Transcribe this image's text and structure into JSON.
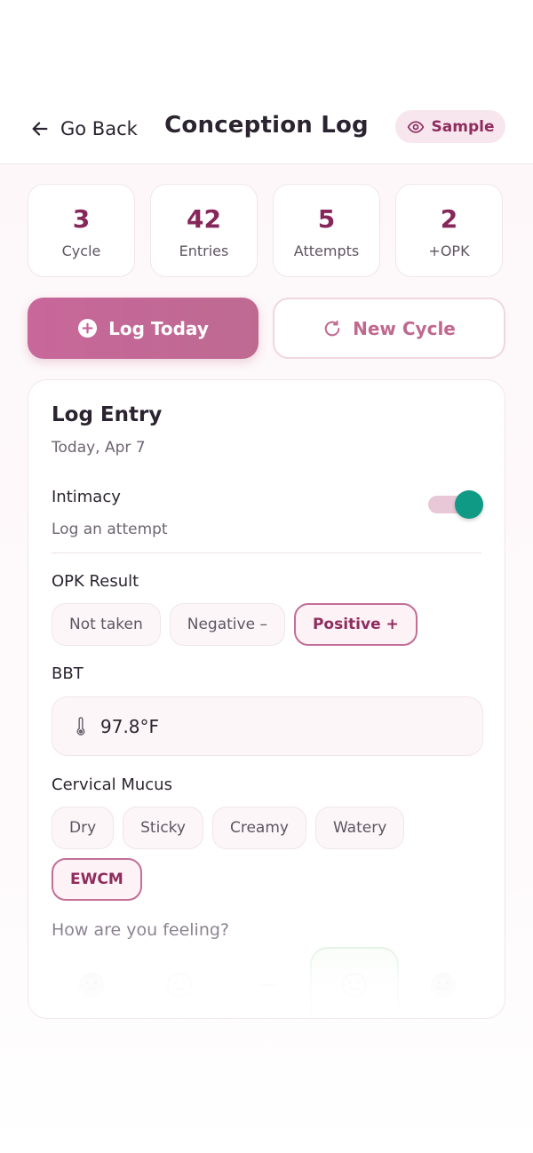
{
  "header": {
    "back_label": "Go Back",
    "title": "Conception Log",
    "sample_label": "Sample"
  },
  "stats": [
    {
      "value": "3",
      "label": "Cycle"
    },
    {
      "value": "42",
      "label": "Entries"
    },
    {
      "value": "5",
      "label": "Attempts"
    },
    {
      "value": "2",
      "label": "+OPK"
    }
  ],
  "actions": {
    "log_today": "Log Today",
    "new_cycle": "New Cycle"
  },
  "entry": {
    "title": "Log Entry",
    "date": "Today, Apr 7",
    "intimacy": {
      "label": "Intimacy",
      "sub": "Log an attempt",
      "on": true
    },
    "opk": {
      "label": "OPK Result",
      "options": [
        "Not taken",
        "Negative –",
        "Positive +"
      ],
      "selected": "Positive +"
    },
    "bbt": {
      "label": "BBT",
      "value": "97.8°F"
    },
    "mucus": {
      "label": "Cervical Mucus",
      "options": [
        "Dry",
        "Sticky",
        "Creamy",
        "Watery",
        "EWCM"
      ],
      "selected": "EWCM"
    },
    "feeling_label": "How are you feeling?"
  },
  "colors": {
    "accent": "#86275a",
    "primary_button": "#c8679a",
    "toggle_on": "#0f9a86"
  }
}
